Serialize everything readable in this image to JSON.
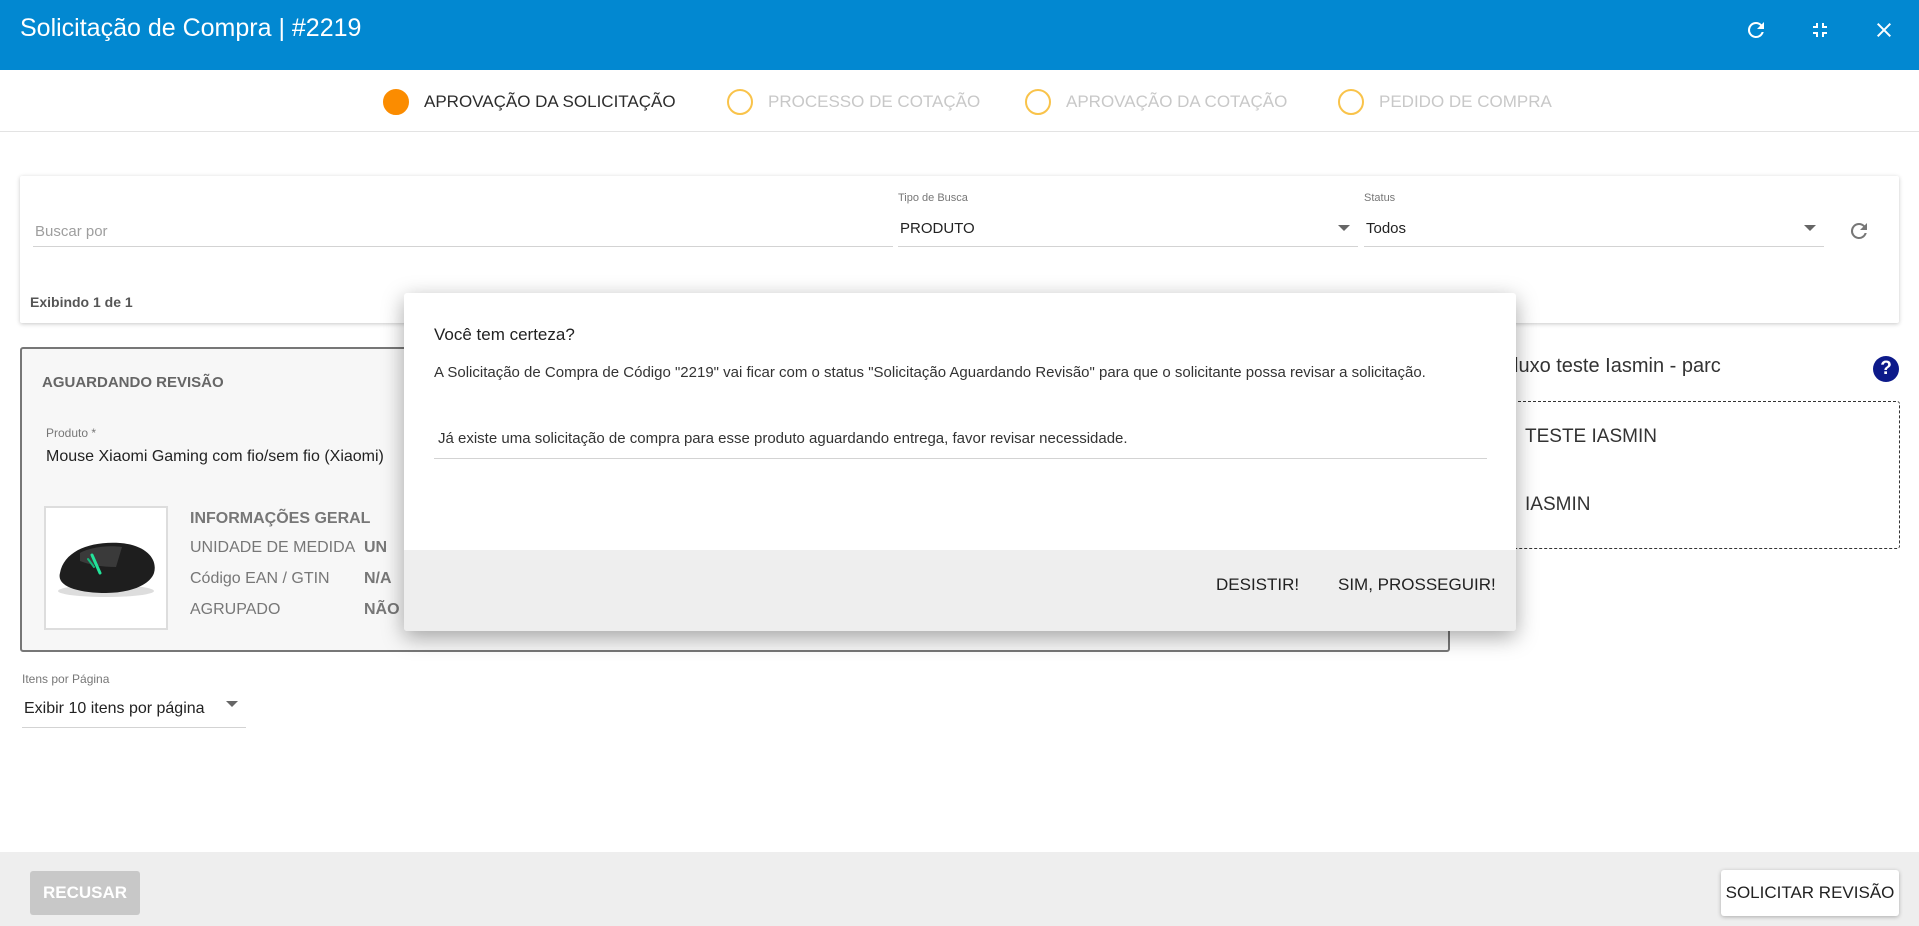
{
  "window": {
    "title": "Solicitação de Compra | #2219",
    "accent_color": "#0288d1",
    "controls": [
      "refresh-icon",
      "minimize-icon",
      "close-icon"
    ]
  },
  "steps": [
    {
      "label": "APROVAÇÃO DA SOLICITAÇÃO",
      "active": true
    },
    {
      "label": "PROCESSO DE COTAÇÃO",
      "active": false
    },
    {
      "label": "APROVAÇÃO DA COTAÇÃO",
      "active": false
    },
    {
      "label": "PEDIDO DE COMPRA",
      "active": false
    }
  ],
  "filters": {
    "search_placeholder": "Buscar por",
    "search_value": "",
    "tipo_busca_label": "Tipo de Busca",
    "tipo_busca_value": "PRODUTO",
    "status_label": "Status",
    "status_value": "Todos",
    "showing": "Exibindo 1 de 1"
  },
  "item": {
    "status": "AGUARDANDO REVISÃO",
    "produto_label": "Produto *",
    "produto_value": "Mouse Xiaomi Gaming com fio/sem fio (Xiaomi)",
    "info_title": "INFORMAÇÕES GERAL",
    "info": [
      {
        "label": "UNIDADE DE MEDIDA",
        "value": "UN"
      },
      {
        "label": "Código EAN / GTIN",
        "value": "N/A"
      },
      {
        "label": "AGRUPADO",
        "value": "NÃO"
      }
    ]
  },
  "flow": {
    "title": "luxo teste Iasmin - parc",
    "items": [
      "TESTE IASMIN",
      "IASMIN"
    ]
  },
  "pagination": {
    "label": "Itens por Página",
    "value": "Exibir 10 itens por página"
  },
  "footer": {
    "recusar": "RECUSAR",
    "solicitar": "SOLICITAR REVISÃO"
  },
  "dialog": {
    "title": "Você tem certeza?",
    "text": "A Solicitação de Compra de Código \"2219\" vai ficar com o status \"Solicitação Aguardando Revisão\" para que o solicitante possa revisar a solicitação.",
    "input_value": "Já existe uma solicitação de compra para esse produto aguardando entrega, favor revisar necessidade.",
    "cancel": "DESISTIR!",
    "confirm": "SIM, PROSSEGUIR!"
  }
}
